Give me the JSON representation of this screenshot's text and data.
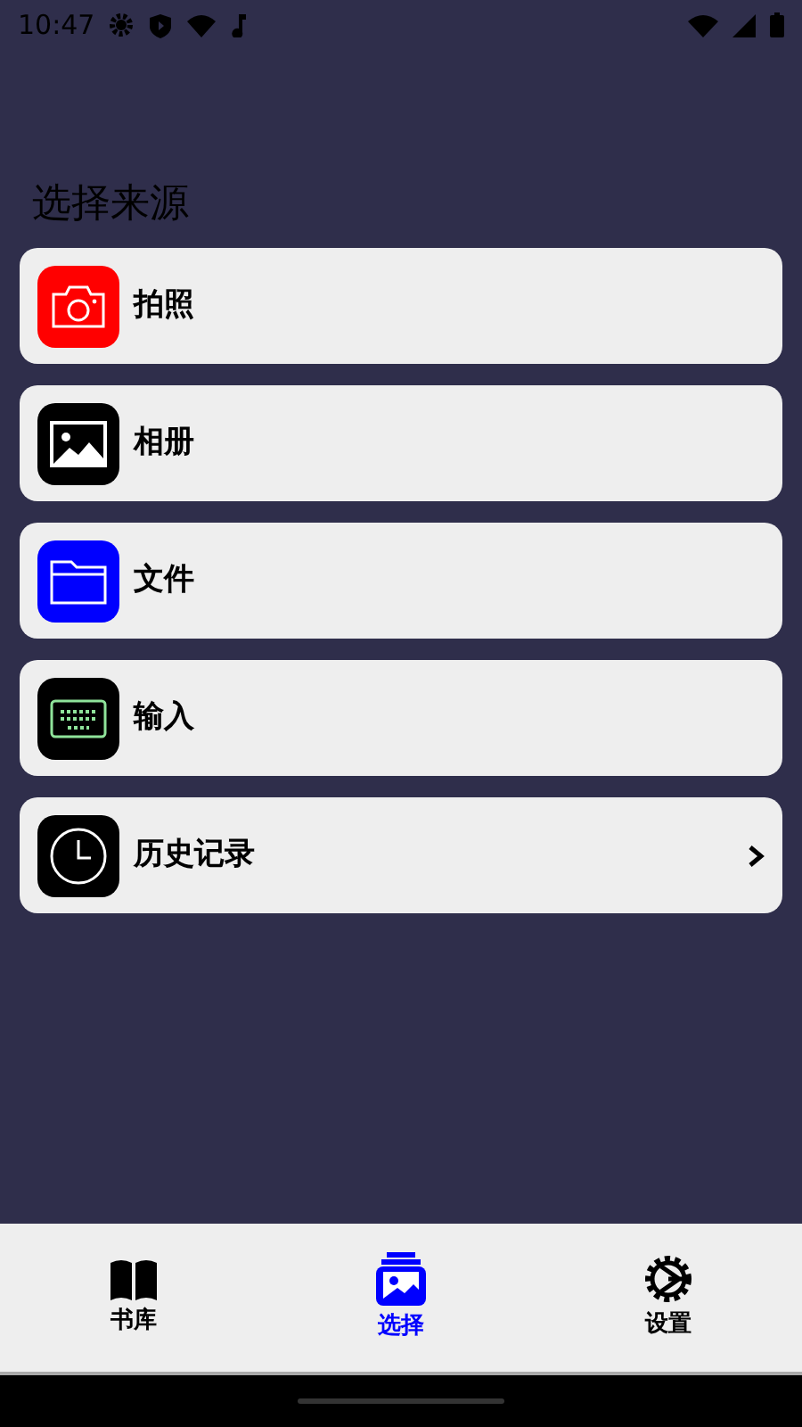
{
  "status_bar": {
    "time": "10:47"
  },
  "title": "选择来源",
  "sources": [
    {
      "kind": "camera",
      "label": "拍照",
      "color": "#ff0000",
      "chevron": false
    },
    {
      "kind": "album",
      "label": "相册",
      "color": "#000000",
      "chevron": false
    },
    {
      "kind": "folder",
      "label": "文件",
      "color": "#0000ff",
      "chevron": false
    },
    {
      "kind": "keyboard",
      "label": "输入",
      "color": "#000000",
      "chevron": false
    },
    {
      "kind": "history",
      "label": "历史记录",
      "color": "#000000",
      "chevron": true
    }
  ],
  "bottom_nav": [
    {
      "kind": "library",
      "label": "书库",
      "selected": false
    },
    {
      "kind": "select",
      "label": "选择",
      "selected": true
    },
    {
      "kind": "settings",
      "label": "设置",
      "selected": false
    }
  ]
}
